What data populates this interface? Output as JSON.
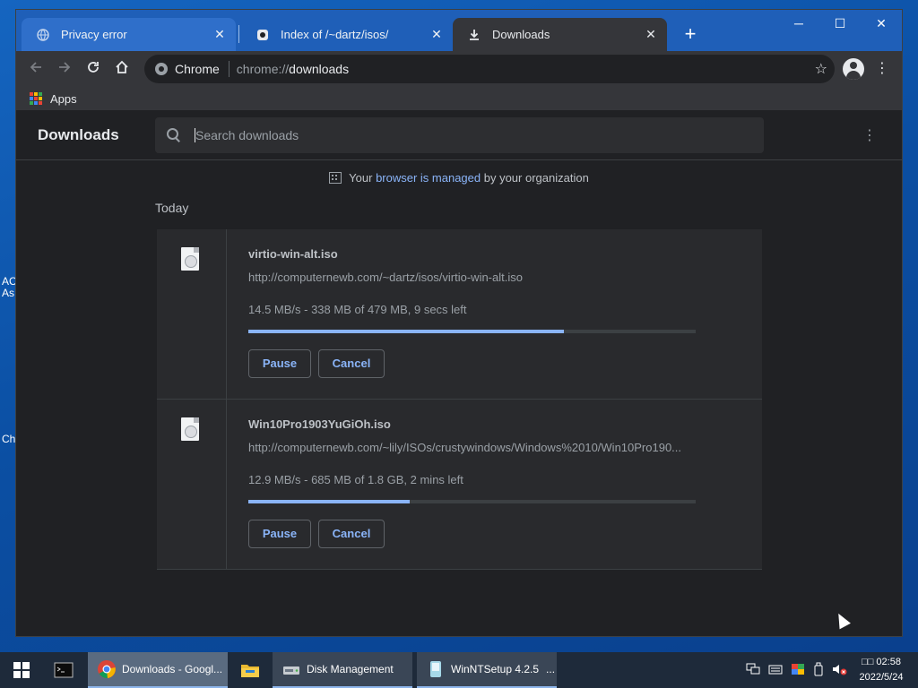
{
  "desktop": {
    "fragments": [
      "AC",
      "As",
      "Ch"
    ]
  },
  "browser": {
    "tabs": [
      {
        "title": "Privacy error",
        "icon": "globe-icon",
        "state": "inactive"
      },
      {
        "title": "Index of /~dartz/isos/",
        "icon": "site-favicon-icon",
        "state": "inactive"
      },
      {
        "title": "Downloads",
        "icon": "download-icon",
        "state": "active"
      }
    ],
    "window_controls": {
      "minimize": "─",
      "maximize": "☐",
      "close": "✕"
    },
    "omnibox": {
      "chip_label": "Chrome",
      "url_scheme": "chrome://",
      "url_host": "downloads"
    },
    "bookmarks": {
      "apps_label": "Apps"
    }
  },
  "downloads_page": {
    "title": "Downloads",
    "search_placeholder": "Search downloads",
    "managed_prefix": "Your ",
    "managed_link": "browser is managed",
    "managed_suffix": " by your organization",
    "section_label": "Today",
    "items": [
      {
        "filename": "virtio-win-alt.iso",
        "url": "http://computernewb.com/~dartz/isos/virtio-win-alt.iso",
        "status": "14.5 MB/s - 338 MB of 479 MB, 9 secs left",
        "progress": 0.706,
        "pause_label": "Pause",
        "cancel_label": "Cancel"
      },
      {
        "filename": "Win10Pro1903YuGiOh.iso",
        "url": "http://computernewb.com/~lily/ISOs/crustywindows/Windows%2010/Win10Pro190...",
        "status": "12.9 MB/s - 685 MB of 1.8 GB, 2 mins left",
        "progress": 0.36,
        "pause_label": "Pause",
        "cancel_label": "Cancel"
      }
    ]
  },
  "taskbar": {
    "items": [
      {
        "label": "",
        "icon": "terminal-icon"
      },
      {
        "label": "Downloads - Googl...",
        "icon": "chrome-icon"
      },
      {
        "label": "",
        "icon": "folder-icon"
      },
      {
        "label": "Disk Management",
        "icon": "disk-management-icon"
      },
      {
        "label": "WinNTSetup 4.2.5",
        "icon": "winntsetup-icon"
      },
      {
        "label": "...",
        "icon": ""
      }
    ],
    "clock_time": "02:58",
    "clock_prefix": "□□",
    "clock_date": "2022/5/24"
  },
  "colors": {
    "accent": "#8ab4f8",
    "page_bg": "#202124",
    "card_bg": "#292a2d",
    "titlebar": "#1f5fb8"
  }
}
